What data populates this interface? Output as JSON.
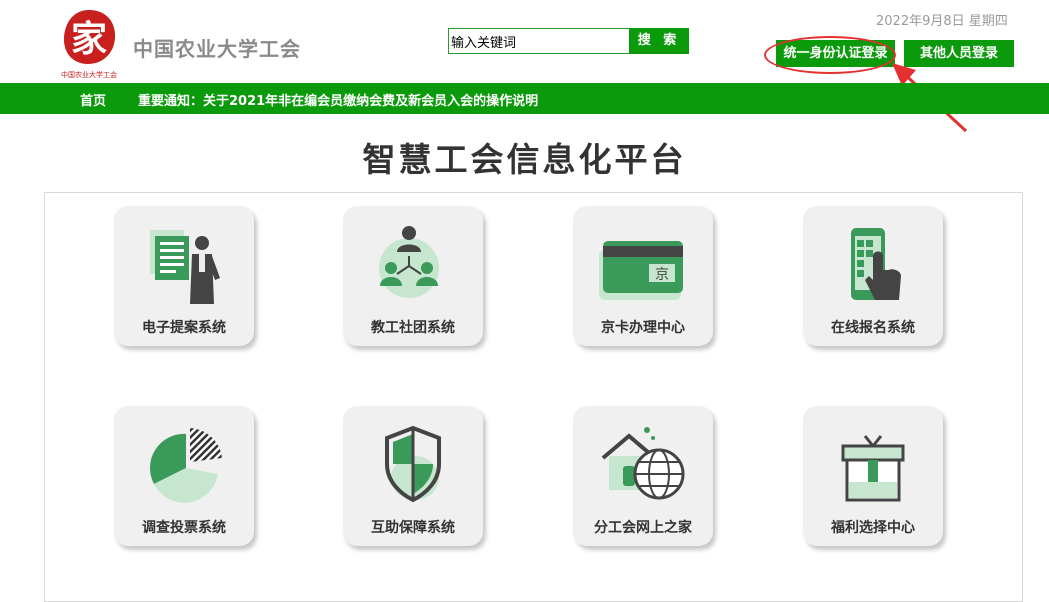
{
  "header": {
    "logo_char": "家",
    "logo_caption": "中国农业大学工会",
    "site_name": "中国农业大学工会",
    "date_text": "2022年9月8日  星期四"
  },
  "search": {
    "value": "输入关键词",
    "button_label": "搜 索"
  },
  "login": {
    "unified_label": "统一身份认证登录",
    "other_label": "其他人员登录"
  },
  "nav": {
    "home": "首页",
    "notice": "重要通知：关于2021年非在编会员缴纳会费及新会员入会的操作说明"
  },
  "main": {
    "title": "智慧工会信息化平台",
    "tiles": [
      {
        "label": "电子提案系统",
        "icon": "proposal-icon"
      },
      {
        "label": "教工社团系统",
        "icon": "org-chart-icon"
      },
      {
        "label": "京卡办理中心",
        "icon": "card-icon"
      },
      {
        "label": "在线报名系统",
        "icon": "phone-tap-icon"
      },
      {
        "label": "调查投票系统",
        "icon": "pie-chart-icon"
      },
      {
        "label": "互助保障系统",
        "icon": "shield-icon"
      },
      {
        "label": "分工会网上之家",
        "icon": "home-globe-icon"
      },
      {
        "label": "福利选择中心",
        "icon": "gift-box-icon"
      }
    ],
    "card_char": "京"
  },
  "colors": {
    "brand_green": "#0b9a0b",
    "icon_green": "#3a9a5a",
    "annotation_red": "#e53030",
    "logo_red": "#c8201e"
  }
}
